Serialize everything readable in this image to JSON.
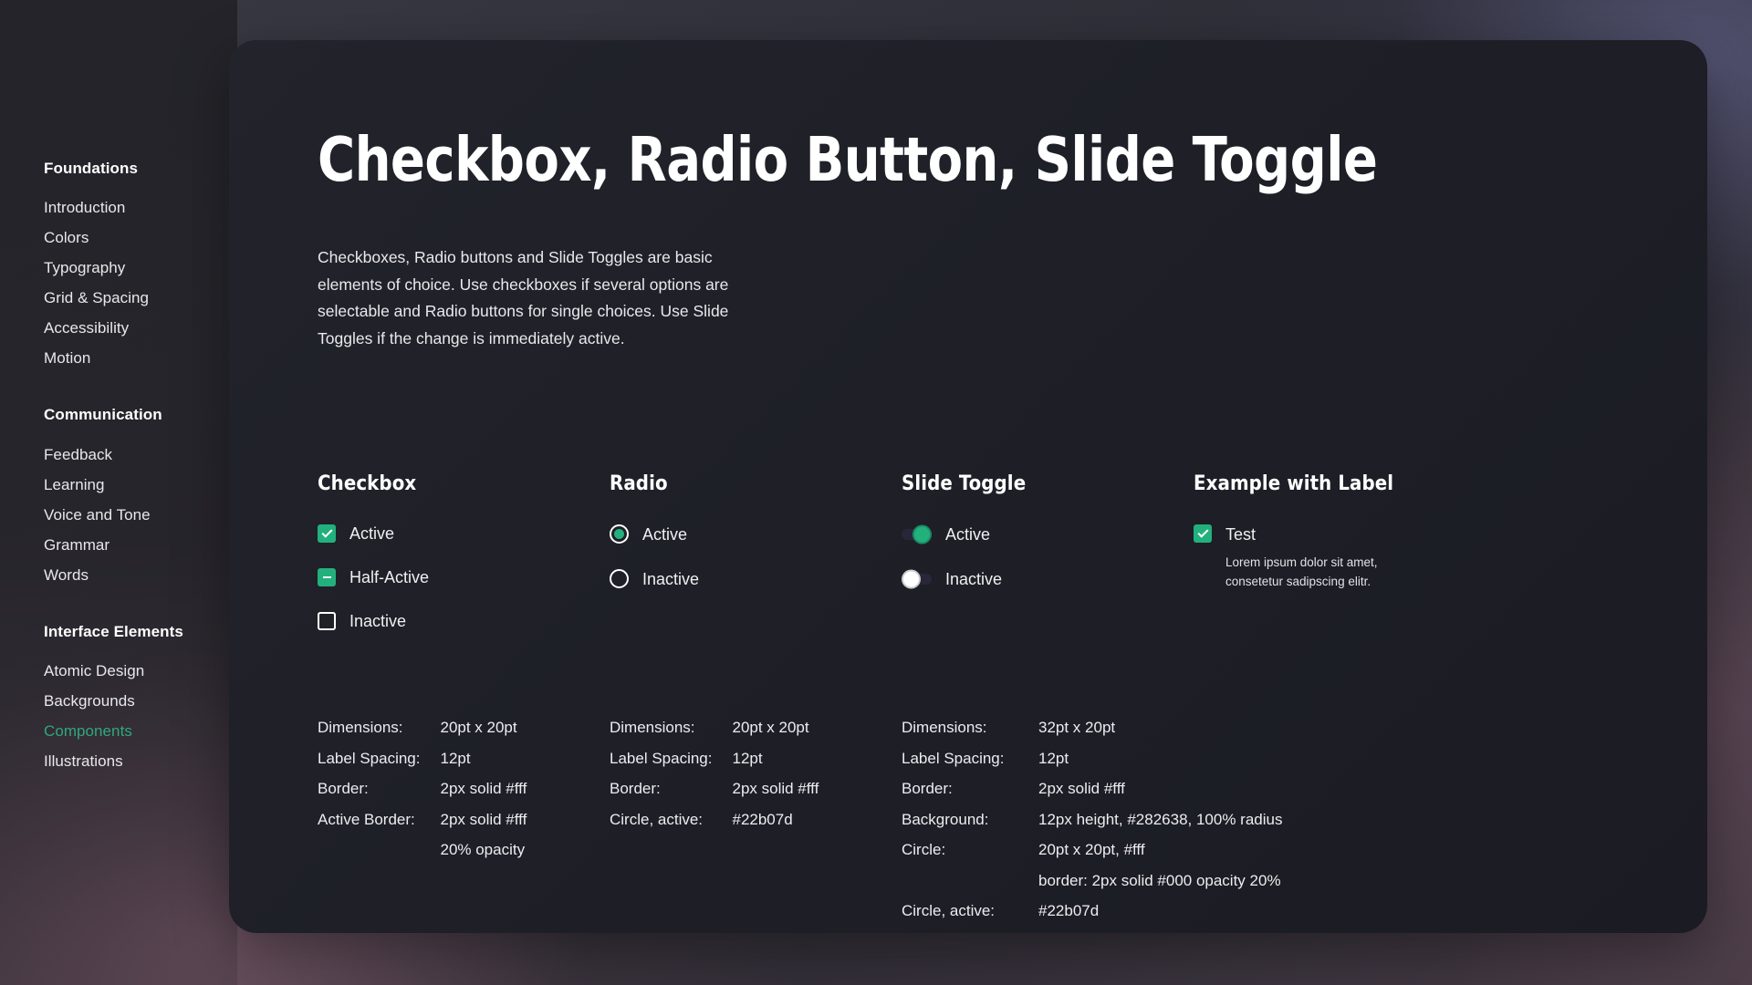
{
  "sidebar": {
    "groups": [
      {
        "title": "Foundations",
        "items": [
          {
            "label": "Introduction",
            "active": false
          },
          {
            "label": "Colors",
            "active": false
          },
          {
            "label": "Typography",
            "active": false
          },
          {
            "label": "Grid & Spacing",
            "active": false
          },
          {
            "label": "Accessibility",
            "active": false
          },
          {
            "label": "Motion",
            "active": false
          }
        ]
      },
      {
        "title": "Communication",
        "items": [
          {
            "label": "Feedback",
            "active": false
          },
          {
            "label": "Learning",
            "active": false
          },
          {
            "label": "Voice and Tone",
            "active": false
          },
          {
            "label": "Grammar",
            "active": false
          },
          {
            "label": "Words",
            "active": false
          }
        ]
      },
      {
        "title": "Interface Elements",
        "items": [
          {
            "label": "Atomic Design",
            "active": false
          },
          {
            "label": "Backgrounds",
            "active": false
          },
          {
            "label": "Components",
            "active": true
          },
          {
            "label": "Illustrations",
            "active": false
          }
        ]
      }
    ]
  },
  "main": {
    "title": "Checkbox, Radio Button, Slide Toggle",
    "intro": "Checkboxes, Radio buttons and Slide Toggles are basic elements of choice. Use checkboxes if several options are selectable and Radio buttons for single choices. Use Slide Toggles if the change is immediately active."
  },
  "columns": {
    "checkbox": {
      "title": "Checkbox",
      "options": [
        {
          "state": "on",
          "label": "Active"
        },
        {
          "state": "half",
          "label": "Half-Active"
        },
        {
          "state": "off",
          "label": "Inactive"
        }
      ],
      "specs": [
        {
          "key": "Dimensions:",
          "value": "20pt x 20pt"
        },
        {
          "key": "Label Spacing:",
          "value": "12pt"
        },
        {
          "key": "Border:",
          "value": "2px solid #fff"
        },
        {
          "key": "Active Border:",
          "value": "2px solid #fff"
        },
        {
          "key": "",
          "value": "20% opacity"
        }
      ]
    },
    "radio": {
      "title": "Radio",
      "options": [
        {
          "state": "on",
          "label": "Active"
        },
        {
          "state": "off",
          "label": "Inactive"
        }
      ],
      "specs": [
        {
          "key": "Dimensions:",
          "value": "20pt x 20pt"
        },
        {
          "key": "Label Spacing:",
          "value": "12pt"
        },
        {
          "key": "Border:",
          "value": "2px solid #fff"
        },
        {
          "key": "Circle, active:",
          "value": "#22b07d"
        }
      ]
    },
    "slide_toggle": {
      "title": "Slide Toggle",
      "options": [
        {
          "state": "on",
          "label": "Active"
        },
        {
          "state": "off",
          "label": "Inactive"
        }
      ],
      "specs": [
        {
          "key": "Dimensions:",
          "value": "32pt x 20pt"
        },
        {
          "key": "Label Spacing:",
          "value": "12pt"
        },
        {
          "key": "Border:",
          "value": "2px solid #fff"
        },
        {
          "key": "Background:",
          "value": "12px height, #282638, 100% radius"
        },
        {
          "key": "Circle:",
          "value": "20pt x 20pt, #fff"
        },
        {
          "key": "",
          "value": "border: 2px solid #000 opacity 20%"
        },
        {
          "key": "Circle, active:",
          "value": "#22b07d"
        }
      ]
    },
    "example": {
      "title": "Example with Label",
      "item": {
        "state": "on",
        "label": "Test",
        "description": "Lorem ipsum dolor sit amet, consetetur sadipscing elitr."
      }
    }
  },
  "colors": {
    "accent_green": "#22b07d",
    "nav_active": "#2fa87a",
    "toggle_track": "#282638",
    "card_bg": "#1e1f27",
    "text": "#ffffff"
  }
}
